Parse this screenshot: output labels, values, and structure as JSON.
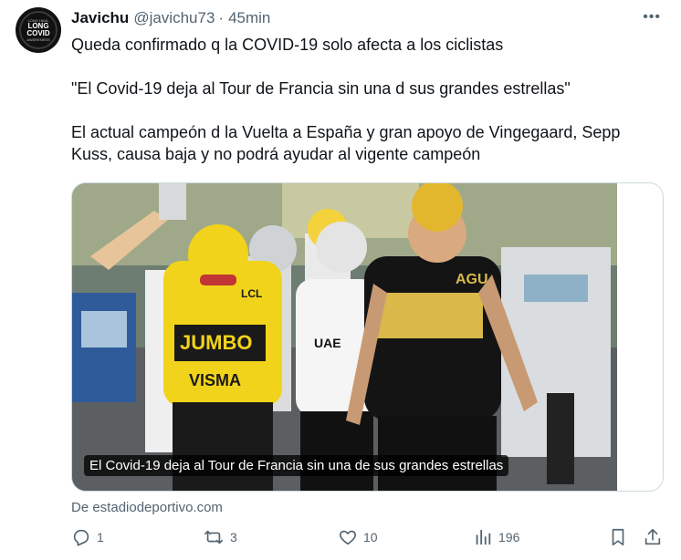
{
  "author": {
    "name": "Javichu",
    "handle": "@javichu73",
    "separator": "·",
    "time": "45min",
    "avatar_text": {
      "line1": "LONG",
      "line2": "COVID",
      "ring_top": "LONG HAUL",
      "ring_bottom": "AWARENESS"
    }
  },
  "menu": {
    "more_label": "•••"
  },
  "tweet": {
    "text": "Queda confirmado q la COVID-19 solo afecta a los ciclistas\n\n\"El Covid-19 deja al Tour de Francia sin una d sus grandes estrellas\"\n\nEl actual campeón d la Vuelta a España y gran apoyo de Vingegaard, Sepp Kuss, causa baja y no podrá ayudar al vigente campeón"
  },
  "card": {
    "caption": "El Covid-19 deja al Tour de Francia sin una de sus grandes estrellas",
    "source": "De estadiodeportivo.com",
    "jersey_texts": [
      "JUMBO",
      "VISMA",
      "LCL",
      "UAE",
      "AGU"
    ],
    "photo_description_icon": "cyclists-photo"
  },
  "actions": {
    "reply": {
      "icon": "reply-icon",
      "count": "1"
    },
    "retweet": {
      "icon": "retweet-icon",
      "count": "3"
    },
    "like": {
      "icon": "heart-icon",
      "count": "10"
    },
    "views": {
      "icon": "views-icon",
      "count": "196"
    },
    "bookmark": {
      "icon": "bookmark-icon"
    },
    "share": {
      "icon": "share-icon"
    }
  },
  "colors": {
    "text": "#0f1419",
    "secondary": "#536471",
    "border": "#cfd9de",
    "jersey_yellow": "#f2d31b"
  }
}
